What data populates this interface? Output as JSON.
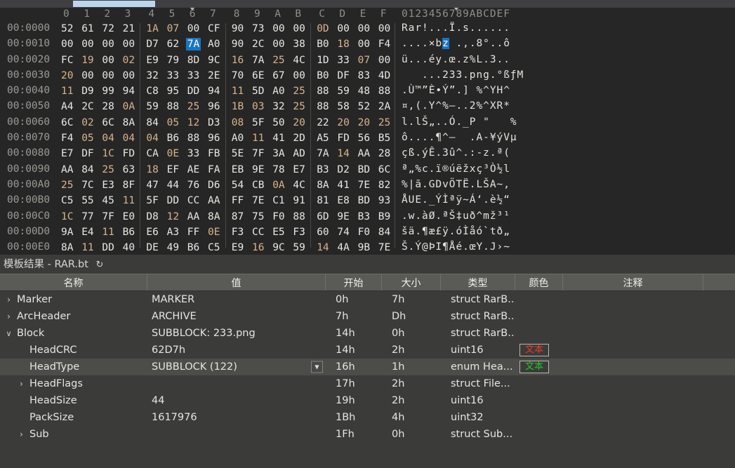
{
  "window": {
    "scrollbar": {
      "name": "horizontal-scrollbar"
    }
  },
  "hex_view": {
    "column_header": "0  1  2  3   4  5  6  7   8  9  A  B   C  D  E  F",
    "ascii_header": "0123456789ABCDEF",
    "columns": [
      "0",
      "1",
      "2",
      "3",
      "4",
      "5",
      "6",
      "7",
      "8",
      "9",
      "A",
      "B",
      "C",
      "D",
      "E",
      "F"
    ],
    "selection": {
      "offset": "00:0016",
      "byte": "7A",
      "ascii": "z"
    },
    "rows": [
      {
        "addr": "00:0000",
        "bytes": [
          "52",
          "61",
          "72",
          "21",
          "1A",
          "07",
          "00",
          "CF",
          "90",
          "73",
          "00",
          "00",
          "0D",
          "00",
          "00",
          "00"
        ],
        "ascii": "Rar!...Ï.s......"
      },
      {
        "addr": "00:0010",
        "bytes": [
          "00",
          "00",
          "00",
          "00",
          "D7",
          "62",
          "7A",
          "A0",
          "90",
          "2C",
          "00",
          "38",
          "B0",
          "18",
          "00",
          "F4"
        ],
        "ascii": "....×bz .,.8°..ô"
      },
      {
        "addr": "00:0020",
        "bytes": [
          "FC",
          "19",
          "00",
          "02",
          "E9",
          "79",
          "8D",
          "9C",
          "16",
          "7A",
          "25",
          "4C",
          "1D",
          "33",
          "07",
          "00"
        ],
        "ascii": "ü...éy.œ.z%L.3.."
      },
      {
        "addr": "00:0030",
        "bytes": [
          "20",
          "00",
          "00",
          "00",
          "32",
          "33",
          "33",
          "2E",
          "70",
          "6E",
          "67",
          "00",
          "B0",
          "DF",
          "83",
          "4D"
        ],
        "ascii": "   ...233.png.°ßƒM"
      },
      {
        "addr": "00:0040",
        "bytes": [
          "11",
          "D9",
          "99",
          "94",
          "C8",
          "95",
          "DD",
          "94",
          "11",
          "5D",
          "A0",
          "25",
          "88",
          "59",
          "48",
          "88"
        ],
        "ascii": ".Ù™”È•Ý”.] %^YH^"
      },
      {
        "addr": "00:0050",
        "bytes": [
          "A4",
          "2C",
          "28",
          "0A",
          "59",
          "88",
          "25",
          "96",
          "1B",
          "03",
          "32",
          "25",
          "88",
          "58",
          "52",
          "2A"
        ],
        "ascii": "¤,(.Y^%–..2%^XR*"
      },
      {
        "addr": "00:0060",
        "bytes": [
          "6C",
          "02",
          "6C",
          "8A",
          "84",
          "05",
          "12",
          "D3",
          "08",
          "5F",
          "50",
          "20",
          "22",
          "20",
          "20",
          "25"
        ],
        "ascii": "l.lŠ„..Ó._P \"   %"
      },
      {
        "addr": "00:0070",
        "bytes": [
          "F4",
          "05",
          "04",
          "04",
          "04",
          "B6",
          "88",
          "96",
          "A0",
          "11",
          "41",
          "2D",
          "A5",
          "FD",
          "56",
          "B5"
        ],
        "ascii": "ô....¶^–  .A-¥ýVµ"
      },
      {
        "addr": "00:0080",
        "bytes": [
          "E7",
          "DF",
          "1C",
          "FD",
          "CA",
          "0E",
          "33",
          "FB",
          "5E",
          "7F",
          "3A",
          "AD",
          "7A",
          "14",
          "AA",
          "28"
        ],
        "ascii": "çß.ýÊ.3û^.:-z.ª("
      },
      {
        "addr": "00:0090",
        "bytes": [
          "AA",
          "84",
          "25",
          "63",
          "18",
          "EF",
          "AE",
          "FA",
          "EB",
          "9E",
          "78",
          "E7",
          "B3",
          "D2",
          "BD",
          "6C"
        ],
        "ascii": "ª„%c.ï®úëžxç³Ò½l"
      },
      {
        "addr": "00:00A0",
        "bytes": [
          "25",
          "7C",
          "E3",
          "8F",
          "47",
          "44",
          "76",
          "D6",
          "54",
          "CB",
          "0A",
          "4C",
          "8A",
          "41",
          "7E",
          "82"
        ],
        "ascii": "%|ã.GDvÖTË.LŠA~‚"
      },
      {
        "addr": "00:00B0",
        "bytes": [
          "C5",
          "55",
          "45",
          "11",
          "5F",
          "DD",
          "CC",
          "AA",
          "FF",
          "7E",
          "C1",
          "91",
          "81",
          "E8",
          "BD",
          "93"
        ],
        "ascii": "ÅUE._ÝÌªÿ~Á‘.è½“"
      },
      {
        "addr": "00:00C0",
        "bytes": [
          "1C",
          "77",
          "7F",
          "E0",
          "D8",
          "12",
          "AA",
          "8A",
          "87",
          "75",
          "F0",
          "88",
          "6D",
          "9E",
          "B3",
          "B9"
        ],
        "ascii": ".w.àØ.ªŠ‡uð^mž³¹"
      },
      {
        "addr": "00:00D0",
        "bytes": [
          "9A",
          "E4",
          "11",
          "B6",
          "E6",
          "A3",
          "FF",
          "0E",
          "F3",
          "CC",
          "E5",
          "F3",
          "60",
          "74",
          "F0",
          "84"
        ],
        "ascii": "šä.¶æ£ÿ.óÌåó`tð„"
      },
      {
        "addr": "00:00E0",
        "bytes": [
          "8A",
          "11",
          "DD",
          "40",
          "DE",
          "49",
          "B6",
          "C5",
          "E9",
          "16",
          "9C",
          "59",
          "14",
          "4A",
          "9B",
          "7E"
        ],
        "ascii": "Š.Ý@ÞI¶Åé.œY.J›~"
      }
    ]
  },
  "template_panel": {
    "title": "模板结果 - RAR.bt",
    "refresh_icon": "refresh-icon",
    "columns": [
      "名称",
      "值",
      "开始",
      "大小",
      "类型",
      "颜色",
      "注释"
    ],
    "rows": [
      {
        "indent": 0,
        "twisty": "collapsed",
        "name": "Marker",
        "value": "MARKER",
        "start": "0h",
        "size": "7h",
        "type": "struct RarB...",
        "color": "",
        "color_kind": "",
        "comment": "",
        "selected": false,
        "combo": false
      },
      {
        "indent": 0,
        "twisty": "collapsed",
        "name": "ArcHeader",
        "value": "ARCHIVE",
        "start": "7h",
        "size": "Dh",
        "type": "struct RarB...",
        "color": "",
        "color_kind": "",
        "comment": "",
        "selected": false,
        "combo": false
      },
      {
        "indent": 0,
        "twisty": "expanded",
        "name": "Block",
        "value": "SUBBLOCK: 233.png",
        "start": "14h",
        "size": "0h",
        "type": "struct RarB...",
        "color": "",
        "color_kind": "",
        "comment": "",
        "selected": false,
        "combo": false
      },
      {
        "indent": 1,
        "twisty": "none",
        "name": "HeadCRC",
        "value": "62D7h",
        "start": "14h",
        "size": "2h",
        "type": "uint16",
        "color": "文本",
        "color_kind": "red",
        "comment": "",
        "selected": false,
        "combo": false
      },
      {
        "indent": 1,
        "twisty": "none",
        "name": "HeadType",
        "value": "SUBBLOCK (122)",
        "start": "16h",
        "size": "1h",
        "type": "enum Hea...",
        "color": "文本",
        "color_kind": "green",
        "comment": "",
        "selected": true,
        "combo": true
      },
      {
        "indent": 1,
        "twisty": "collapsed",
        "name": "HeadFlags",
        "value": "",
        "start": "17h",
        "size": "2h",
        "type": "struct File...",
        "color": "",
        "color_kind": "",
        "comment": "",
        "selected": false,
        "combo": false
      },
      {
        "indent": 1,
        "twisty": "none",
        "name": "HeadSize",
        "value": "44",
        "start": "19h",
        "size": "2h",
        "type": "uint16",
        "color": "",
        "color_kind": "",
        "comment": "",
        "selected": false,
        "combo": false
      },
      {
        "indent": 1,
        "twisty": "none",
        "name": "PackSize",
        "value": "1617976",
        "start": "1Bh",
        "size": "4h",
        "type": "uint32",
        "color": "",
        "color_kind": "",
        "comment": "",
        "selected": false,
        "combo": false
      },
      {
        "indent": 1,
        "twisty": "collapsed",
        "name": "Sub",
        "value": "",
        "start": "1Fh",
        "size": "0h",
        "type": "struct Sub...",
        "color": "",
        "color_kind": "",
        "comment": "",
        "selected": false,
        "combo": false
      }
    ]
  },
  "colors": {
    "accent": "#1776c4",
    "scrollbar_thumb": "#bcd6ee",
    "hex_bg": "#262626",
    "panel_bg": "#3b3b3a",
    "header_bg": "#5a5a57",
    "selected_row": "#4c4c49",
    "red_text": "#f03a2a",
    "green_text": "#22cc2a"
  }
}
